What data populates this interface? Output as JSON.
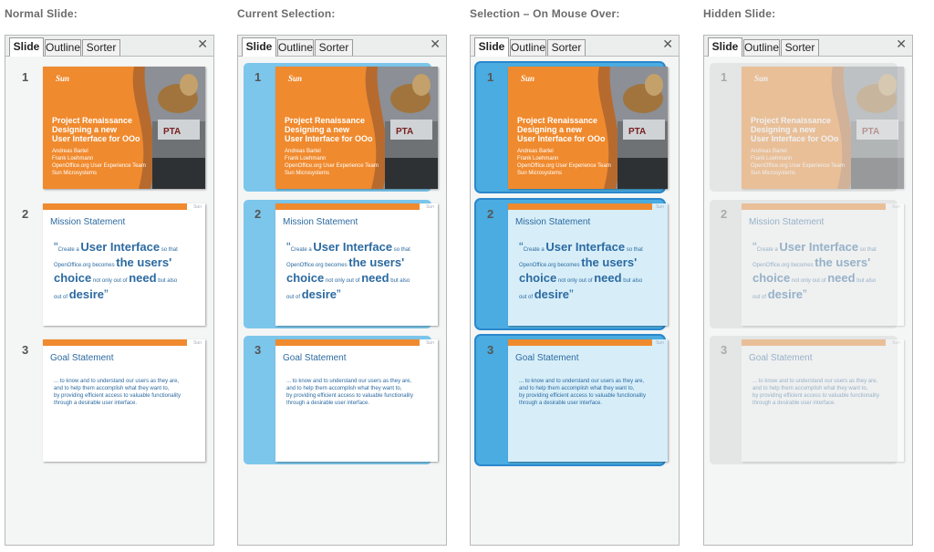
{
  "columns": [
    {
      "title": "Normal Slide:",
      "state": "normal"
    },
    {
      "title": "Current Selection:",
      "state": "selected"
    },
    {
      "title": "Selection – On Mouse Over:",
      "state": "hover"
    },
    {
      "title": "Hidden Slide:",
      "state": "hidden"
    }
  ],
  "tabs": {
    "slide": "Slide",
    "outline": "Outline",
    "sorter": "Sorter",
    "close_icon": "close-icon",
    "close_glyph": "✕"
  },
  "slides": [
    {
      "number": "1",
      "logo": "Sun",
      "title_lines": [
        "Project Renaissance",
        "Designing a new",
        "User Interface for OOo"
      ],
      "subtitle_lines": [
        "Andreas Bartel",
        "Frank Loehmann",
        "OpenOffice.org User Experience Team",
        "Sun Microsystems"
      ]
    },
    {
      "number": "2",
      "title": "Mission Statement",
      "logo_small": "Sun",
      "quote": {
        "open": "“",
        "w1": "Create a ",
        "w2": "User Interface",
        "w3": " so that",
        "w4": "OpenOffice.org becomes ",
        "w5": "the users'",
        "w6": "choice",
        "w7": " not only out of ",
        "w8": "need",
        "w9": " but also",
        "w10": "out of ",
        "w11": "desire",
        "close": "”"
      }
    },
    {
      "number": "3",
      "title": "Goal Statement",
      "logo_small": "Sun",
      "lines": [
        "... to know and to understand our users as they are,",
        "and to help them accomplish what they want to,",
        "by providing efficient access to valuable functionality",
        "through a desirable user interface."
      ]
    }
  ],
  "colors": {
    "orange": "#f08a2e",
    "selection": "#7cc6ec",
    "hover": "#4aace0",
    "hover_border": "#2a88cc",
    "text_blue": "#2c6aa0"
  }
}
